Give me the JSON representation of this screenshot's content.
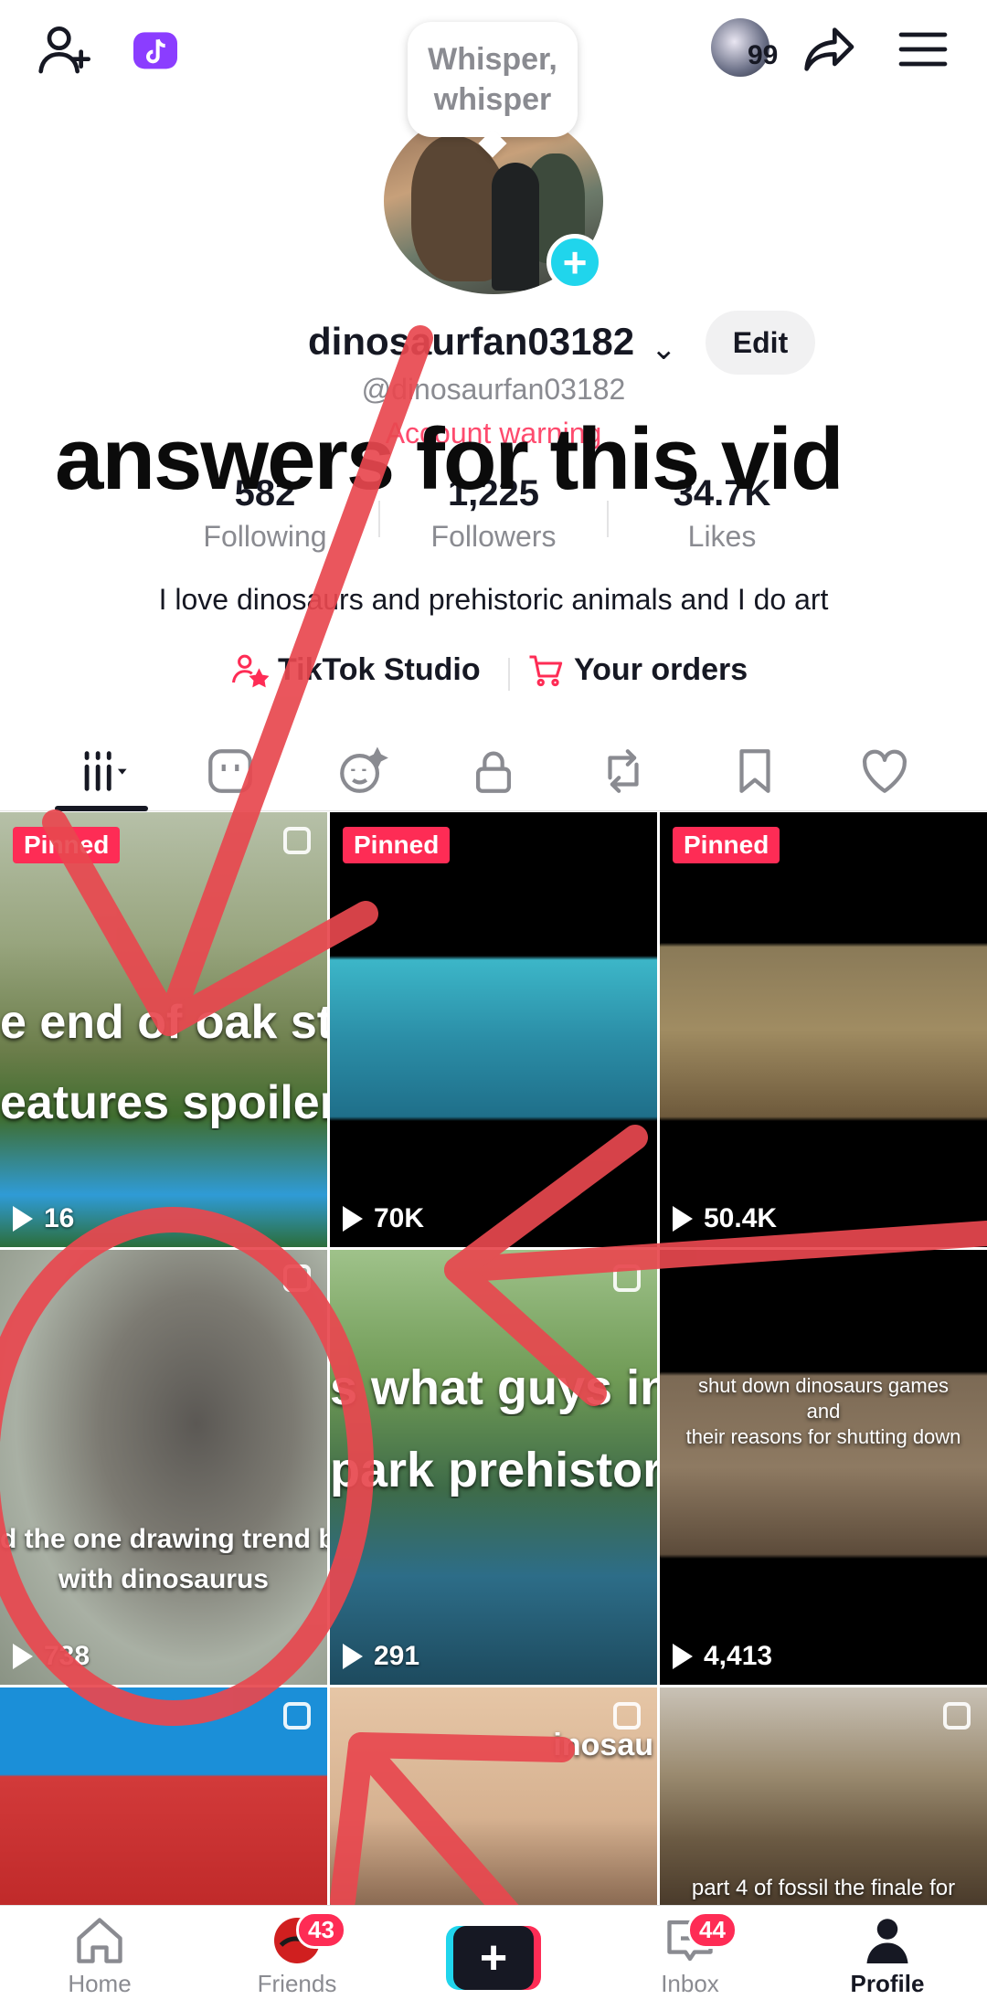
{
  "bubble": {
    "line1": "Whisper,",
    "line2": "whisper"
  },
  "story": {
    "count": "99"
  },
  "profile": {
    "username": "dinosaurfan03182",
    "handle": "@dinosaurfan03182",
    "warning": "Account warning",
    "edit_label": "Edit",
    "bio": "I love dinosaurs and prehistoric animals and I do art"
  },
  "overlay": {
    "text": "answers for this vid"
  },
  "stats": [
    {
      "value": "582",
      "label": "Following"
    },
    {
      "value": "1,225",
      "label": "Followers"
    },
    {
      "value": "34.7K",
      "label": "Likes"
    }
  ],
  "links": {
    "studio": "TikTok Studio",
    "orders": "Your orders"
  },
  "videos": [
    {
      "pinned": "Pinned",
      "views": "16",
      "caption1": "e end of oak stre",
      "caption2": "eatures spoiler wa"
    },
    {
      "pinned": "Pinned",
      "views": "70K"
    },
    {
      "pinned": "Pinned",
      "views": "50.4K"
    },
    {
      "views": "738",
      "caption1": "d the one drawing trend b",
      "caption2": "with dinosaurus"
    },
    {
      "views": "291",
      "caption1": "s what guys in m",
      "caption2": "park prehistorica"
    },
    {
      "views": "4,413",
      "caption1": "shut down dinosaurs games",
      "caption2": "and",
      "caption3": "their reasons for shutting down"
    },
    {
      "views": ""
    },
    {
      "views": "",
      "caption1": "inosau"
    },
    {
      "views": "",
      "caption1": "part 4 of fossil the finale for"
    }
  ],
  "nav": {
    "home": "Home",
    "friends": "Friends",
    "friends_badge": "43",
    "inbox": "Inbox",
    "inbox_badge": "44",
    "profile": "Profile"
  },
  "colors": {
    "accent": "#fe2c55",
    "cyan": "#20d5ec",
    "annotation": "#e8484f"
  }
}
